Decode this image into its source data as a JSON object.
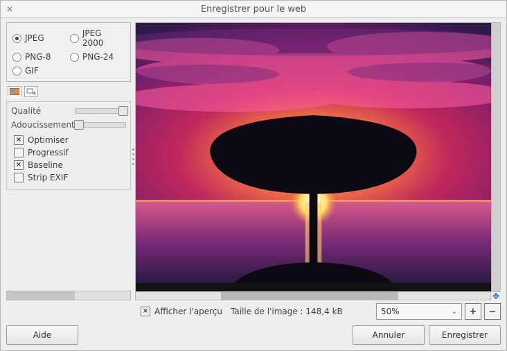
{
  "window": {
    "title": "Enregistrer pour le web"
  },
  "formats": {
    "options": {
      "jpeg": {
        "label": "JPEG",
        "selected": true
      },
      "jp2000": {
        "label": "JPEG 2000",
        "selected": false
      },
      "png8": {
        "label": "PNG-8",
        "selected": false
      },
      "png24": {
        "label": "PNG-24",
        "selected": false
      },
      "gif": {
        "label": "GIF",
        "selected": false
      }
    }
  },
  "sliders": {
    "quality": {
      "label": "Qualité",
      "value_pct": 94
    },
    "smoothing": {
      "label": "Adoucissement",
      "value_pct": 0
    }
  },
  "checks": {
    "optimize": {
      "label": "Optimiser",
      "checked": true
    },
    "progressive": {
      "label": "Progressif",
      "checked": false
    },
    "baseline": {
      "label": "Baseline",
      "checked": true
    },
    "strip_exif": {
      "label": "Strip EXIF",
      "checked": false
    }
  },
  "preview_toggle": {
    "label": "Afficher l'aperçu",
    "checked": true
  },
  "file_size": {
    "label": "Taille de l'image : 148,4 kB"
  },
  "zoom": {
    "value": "50%"
  },
  "buttons": {
    "help": "Aide",
    "cancel": "Annuler",
    "save": "Enregistrer"
  }
}
